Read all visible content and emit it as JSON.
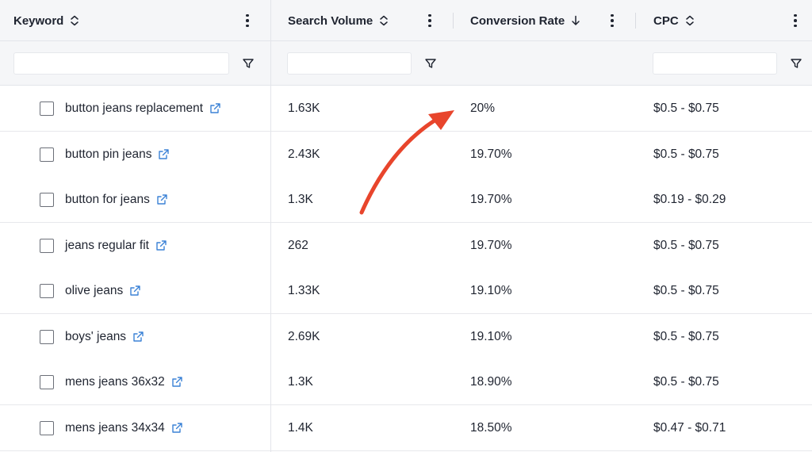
{
  "columns": [
    {
      "label": "Keyword",
      "sort": "unsorted"
    },
    {
      "label": "Search Volume",
      "sort": "unsorted"
    },
    {
      "label": "Conversion Rate",
      "sort": "descending"
    },
    {
      "label": "CPC",
      "sort": "unsorted"
    }
  ],
  "filters": {
    "keyword": {
      "value": "",
      "placeholder": ""
    },
    "search_volume": {
      "value": "",
      "placeholder": ""
    },
    "cpc": {
      "value": "",
      "placeholder": ""
    }
  },
  "rows": [
    {
      "keyword": "button jeans replacement",
      "search_volume": "1.63K",
      "conversion_rate": "20%",
      "cpc": "$0.5 - $0.75"
    },
    {
      "keyword": "button pin jeans",
      "search_volume": "2.43K",
      "conversion_rate": "19.70%",
      "cpc": "$0.5 - $0.75"
    },
    {
      "keyword": "button for jeans",
      "search_volume": "1.3K",
      "conversion_rate": "19.70%",
      "cpc": "$0.19 - $0.29"
    },
    {
      "keyword": "jeans regular fit",
      "search_volume": "262",
      "conversion_rate": "19.70%",
      "cpc": "$0.5 - $0.75"
    },
    {
      "keyword": "olive jeans",
      "search_volume": "1.33K",
      "conversion_rate": "19.10%",
      "cpc": "$0.5 - $0.75"
    },
    {
      "keyword": "boys' jeans",
      "search_volume": "2.69K",
      "conversion_rate": "19.10%",
      "cpc": "$0.5 - $0.75"
    },
    {
      "keyword": "mens jeans 36x32",
      "search_volume": "1.3K",
      "conversion_rate": "18.90%",
      "cpc": "$0.5 - $0.75"
    },
    {
      "keyword": "mens jeans 34x34",
      "search_volume": "1.4K",
      "conversion_rate": "18.50%",
      "cpc": "$0.47 - $0.71"
    }
  ],
  "icons": {
    "sort": "sort-updown-icon",
    "sort_desc": "arrow-down-icon",
    "menu": "kebab-menu-icon",
    "filter": "funnel-filter-icon",
    "external": "external-link-icon",
    "annotation": "red-curved-arrow"
  },
  "colors": {
    "header_bg": "#f5f6f8",
    "link_icon": "#3b82d6",
    "annotation_arrow": "#e8452c"
  }
}
